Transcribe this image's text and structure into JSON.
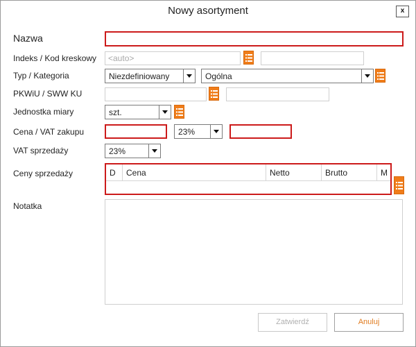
{
  "window": {
    "title": "Nowy asortyment",
    "close_label": "x"
  },
  "form": {
    "name_label": "Nazwa",
    "name_value": "",
    "index_label": "Indeks / Kod kreskowy",
    "index_placeholder": "<auto>",
    "barcode_value": "",
    "type_label": "Typ / Kategoria",
    "type_value": "Niezdefiniowany",
    "category_value": "Ogólna",
    "pkwiu_label": "PKWiU / SWW KU",
    "pkwiu_value": "",
    "pkwiu_extra_value": "",
    "unit_label": "Jednostka miary",
    "unit_value": "szt.",
    "purchase_label": "Cena / VAT zakupu",
    "purchase_price_value": "",
    "purchase_vat_value": "23%",
    "purchase_gross_value": "",
    "sales_vat_label": "VAT sprzedaży",
    "sales_vat_value": "23%",
    "prices_label": "Ceny sprzedaży",
    "prices_columns": [
      "D",
      "Cena",
      "Netto",
      "Brutto",
      "M"
    ],
    "note_label": "Notatka",
    "note_value": ""
  },
  "buttons": {
    "confirm_label": "Zatwierdź",
    "cancel_label": "Anuluj"
  },
  "colors": {
    "required_border": "#cc1a1a",
    "accent_orange": "#f07d1a",
    "cancel_text": "#e07b1f"
  },
  "icons": {
    "list_button": "list-icon",
    "dropdown": "chevron-down-icon",
    "close": "close-icon"
  }
}
